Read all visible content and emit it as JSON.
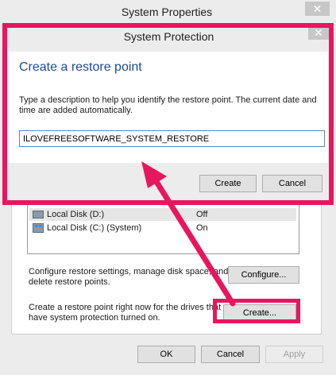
{
  "outer_window": {
    "title": "System Properties",
    "drives": [
      {
        "name": "Local Disk (D:)",
        "protection": "Off"
      },
      {
        "name": "Local Disk (C:) (System)",
        "protection": "On"
      }
    ],
    "configure_text": "Configure restore settings, manage disk space, and delete restore points.",
    "configure_button": "Configure...",
    "create_text": "Create a restore point right now for the drives that have system protection turned on.",
    "create_button": "Create...",
    "ok_button": "OK",
    "cancel_button": "Cancel",
    "apply_button": "Apply"
  },
  "dialog": {
    "title": "System Protection",
    "heading": "Create a restore point",
    "description": "Type a description to help you identify the restore point. The current date and time are added automatically.",
    "input_value": "ILOVEFREESOFTWARE_SYSTEM_RESTORE",
    "create_button": "Create",
    "cancel_button": "Cancel"
  },
  "close_glyph": "✕",
  "colors": {
    "highlight": "#e8155f",
    "heading_blue": "#1e4a8c",
    "input_border": "#5b86c5"
  }
}
